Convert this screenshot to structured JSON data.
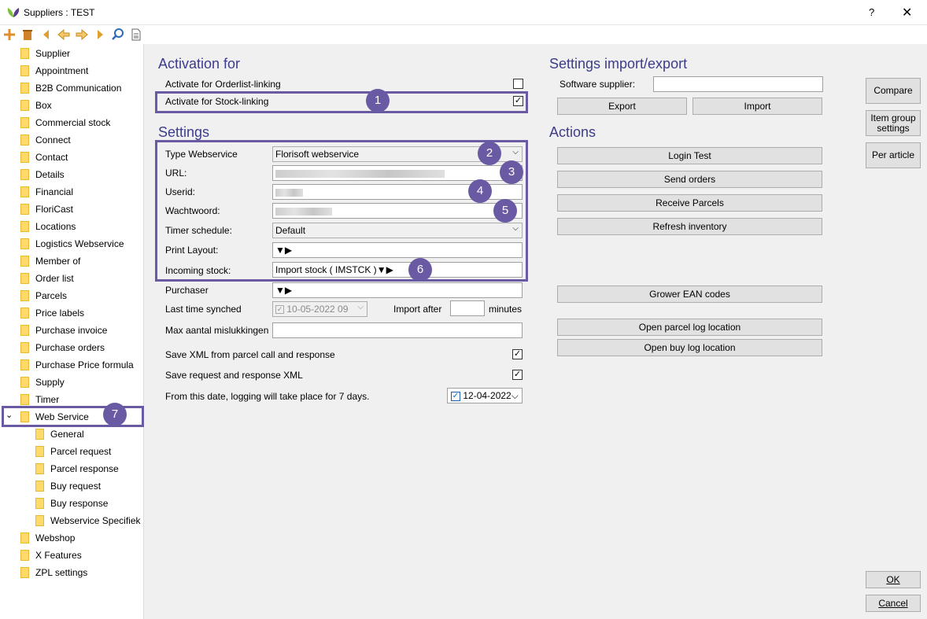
{
  "window": {
    "title": "Suppliers : TEST",
    "help": "?",
    "close": "✕"
  },
  "tree": {
    "items": [
      "Supplier",
      "Appointment",
      "B2B Communication",
      "Box",
      "Commercial stock",
      "Connect",
      "Contact",
      "Details",
      "Financial",
      "FloriCast",
      "Locations",
      "Logistics Webservice",
      "Member of",
      "Order list",
      "Parcels",
      "Price labels",
      "Purchase invoice",
      "Purchase orders",
      "Purchase Price formula",
      "Supply",
      "Timer",
      "Web Service"
    ],
    "children": [
      "General",
      "Parcel request",
      "Parcel response",
      "Buy request",
      "Buy response",
      "Webservice Specifiek"
    ],
    "after": [
      "Webshop",
      "X Features",
      "ZPL settings"
    ],
    "expand_glyph": "⌄"
  },
  "activation": {
    "heading": "Activation for",
    "orderlist_label": "Activate for Orderlist-linking",
    "orderlist_checked": false,
    "stock_label": "Activate for Stock-linking",
    "stock_checked": true
  },
  "settings": {
    "heading": "Settings",
    "type_label": "Type Webservice",
    "type_value": "Florisoft webservice",
    "url_label": "URL:",
    "userid_label": "Userid:",
    "password_label": "Wachtwoord:",
    "timer_label": "Timer schedule:",
    "timer_value": "Default",
    "print_label": "Print Layout:",
    "print_value": "",
    "incoming_label": "Incoming stock:",
    "incoming_value": "Import stock  ( IMSTCK )",
    "purchaser_label": "Purchaser",
    "purchaser_value": "",
    "last_sync_label": "Last time synched",
    "last_sync_value": "10-05-2022 09",
    "import_after_label": "Import after",
    "import_after_value": "",
    "minutes_label": "minutes",
    "max_label": "Max aantal mislukkingen",
    "max_value": "",
    "save_xml_label": "Save XML from parcel call and response",
    "save_xml_checked": true,
    "save_req_label": "Save request and response XML",
    "save_req_checked": true,
    "logging_label": "From this date, logging will take place for 7 days.",
    "logging_date": "12-04-2022"
  },
  "import_export": {
    "heading": "Settings import/export",
    "software_label": "Software supplier:",
    "software_value": "",
    "export": "Export",
    "import": "Import"
  },
  "actions": {
    "heading": "Actions",
    "login_test": "Login Test",
    "send_orders": "Send orders",
    "receive_parcels": "Receive Parcels",
    "refresh_inventory": "Refresh inventory",
    "grower_ean": "Grower EAN codes",
    "open_parcel_log": "Open parcel log location",
    "open_buy_log": "Open buy log location"
  },
  "right_buttons": {
    "compare": "Compare",
    "item_group": "Item group settings",
    "per_article": "Per article",
    "ok": "OK",
    "cancel": "Cancel"
  },
  "badges": [
    "1",
    "2",
    "3",
    "4",
    "5",
    "6",
    "7"
  ],
  "colors": {
    "highlight": "#6a5aa3",
    "heading": "#3c3c8c",
    "folder": "#ffd96a"
  }
}
